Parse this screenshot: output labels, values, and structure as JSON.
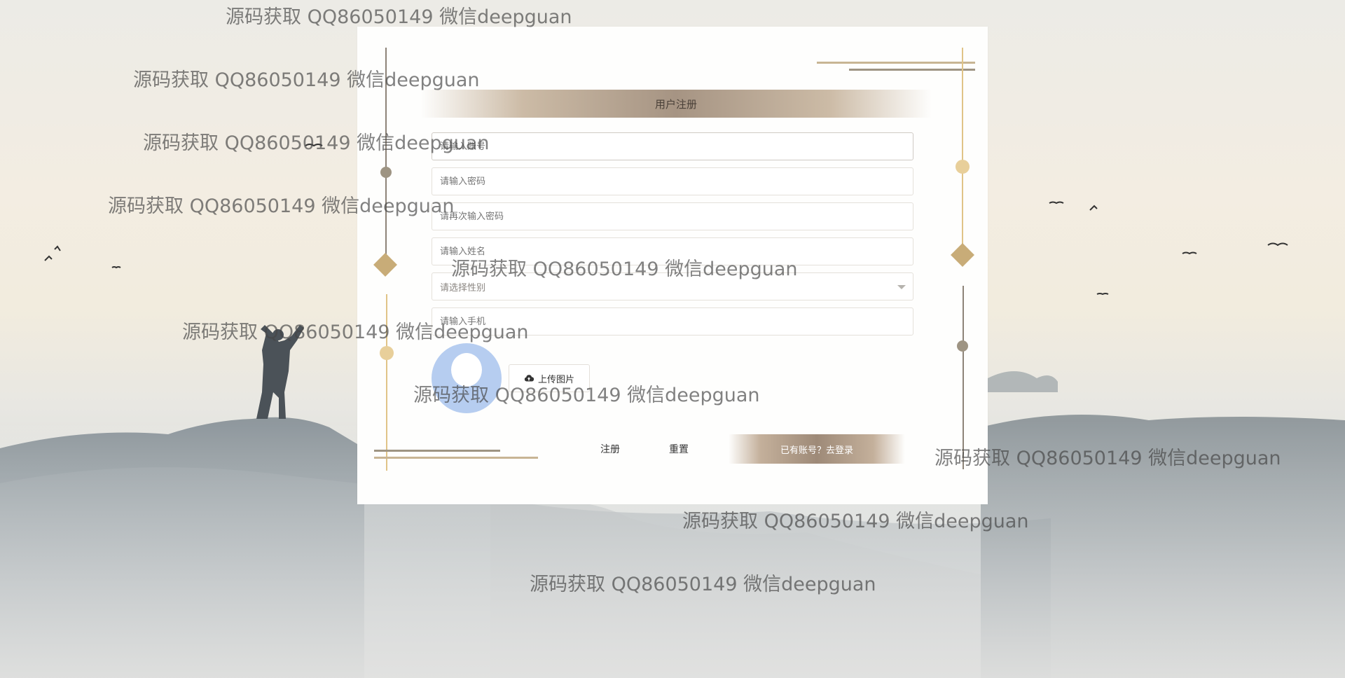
{
  "form": {
    "title": "用户注册",
    "account_placeholder": "请输入账号",
    "password_placeholder": "请输入密码",
    "confirm_password_placeholder": "请再次输入密码",
    "name_placeholder": "请输入姓名",
    "gender_placeholder": "请选择性别",
    "phone_placeholder": "请输入手机",
    "upload_label": "上传图片",
    "register_label": "注册",
    "reset_label": "重置",
    "login_link_label": "已有账号？去登录"
  },
  "watermark": {
    "text": "源码获取 QQ86050149 微信deepguan"
  },
  "colors": {
    "accent_gold": "#e0c488",
    "accent_brown": "#a69483",
    "avatar_blue": "#b6cdf0"
  },
  "icons": {
    "upload": "cloud-upload-icon",
    "select": "chevron-down-icon"
  }
}
